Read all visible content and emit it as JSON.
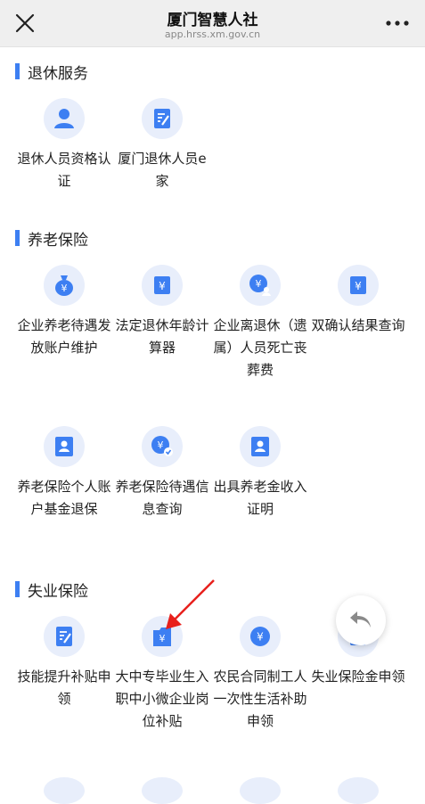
{
  "header": {
    "title": "厦门智慧人社",
    "url": "app.hrss.xm.gov.cn"
  },
  "sections": [
    {
      "title": "退休服务",
      "items": [
        {
          "label": "退休人员资格认证",
          "icon": "person-icon"
        },
        {
          "label": "厦门退休人员e家",
          "icon": "form-edit-icon"
        }
      ]
    },
    {
      "title": "养老保险",
      "items": [
        {
          "label": "企业养老待遇发放账户维护",
          "icon": "money-bag-icon"
        },
        {
          "label": "法定退休年龄计算器",
          "icon": "yuan-doc-icon"
        },
        {
          "label": "企业离退休（遗属）人员死亡丧葬费",
          "icon": "yuan-person-icon"
        },
        {
          "label": "双确认结果查询",
          "icon": "yuan-doc-icon"
        },
        {
          "label": "养老保险个人账户基金退保",
          "icon": "person-card-icon"
        },
        {
          "label": "养老保险待遇信息查询",
          "icon": "yuan-check-icon"
        },
        {
          "label": "出具养老金收入证明",
          "icon": "person-card-icon"
        }
      ]
    },
    {
      "title": "失业保险",
      "items": [
        {
          "label": "技能提升补贴申领",
          "icon": "form-edit-icon"
        },
        {
          "label": "大中专毕业生入职中小微企业岗位补贴",
          "icon": "yuan-folder-icon"
        },
        {
          "label": "农民合同制工人一次性生活补助申领",
          "icon": "yuan-circle-icon"
        },
        {
          "label": "失业保险金申领",
          "icon": "yuan-doc-icon"
        }
      ]
    }
  ],
  "colors": {
    "accent": "#3d7ff2",
    "icon_bg": "#e8eefb",
    "annotation_arrow": "#e8201c"
  }
}
